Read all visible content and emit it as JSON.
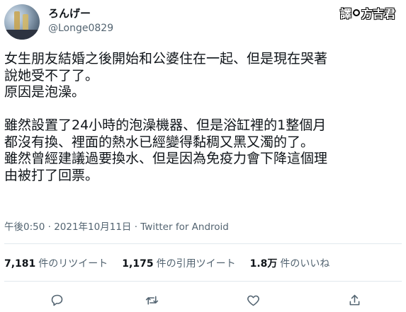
{
  "user": {
    "display_name": "ろんげー",
    "handle": "@Longe0829"
  },
  "watermark": {
    "left": "譯",
    "right": "方吉君"
  },
  "tweet": {
    "text": "女生朋友結婚之後開始和公婆住在一起、但是現在哭著\n說她受不了了。\n原因是泡澡。\n\n雖然設置了24小時的泡澡機器、但是浴缸裡的1整個月\n都沒有換、裡面的熱水已經變得黏稠又黑又濁的了。\n雖然曾經建議過要換水、但是因為免疫力會下降這個理\n由被打了回票。",
    "timestamp": "午後0:50 · 2021年10月11日 · Twitter for Android"
  },
  "stats": {
    "retweets_count": "7,181",
    "retweets_label": "件のリツイート",
    "quotes_count": "1,175",
    "quotes_label": "件の引用ツイート",
    "likes_count": "1.8万",
    "likes_label": "件のいいね"
  },
  "actions": [
    "reply-icon",
    "retweet-icon",
    "like-icon",
    "share-icon"
  ]
}
